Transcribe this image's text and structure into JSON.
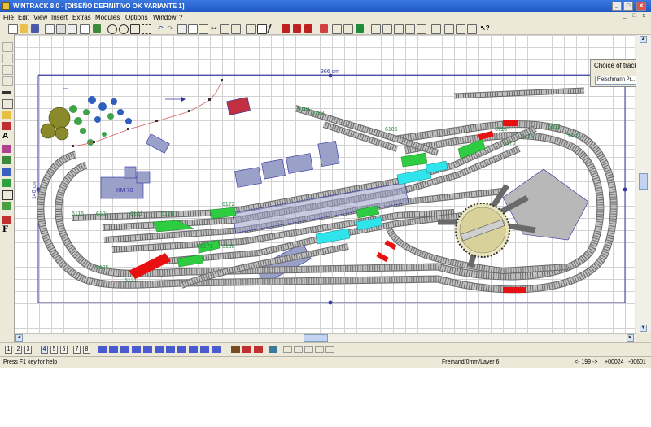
{
  "window": {
    "title": "WINTRACK 8.0 - [DISEÑO DEFINITIVO OK VARIANTE 1]",
    "controls": [
      "_",
      "□",
      "✕"
    ]
  },
  "menu": [
    "File",
    "Edit",
    "View",
    "Insert",
    "Extras",
    "Modules",
    "Options",
    "Window",
    "?"
  ],
  "mdi_controls": [
    "_",
    "□",
    "x"
  ],
  "choice_panel": {
    "title": "Choice of track",
    "selected": "Fleischmann Pr..."
  },
  "layout": {
    "width_label": "366 cm",
    "height_label": "140 cm",
    "station_label": "KM 70",
    "track_labels": [
      "6101",
      "6103",
      "6106",
      "6116",
      "6125",
      "6131",
      "6133",
      "6138",
      "6170",
      "6171",
      "6172",
      "6116",
      "6101",
      "6101",
      "6101",
      "6131",
      "6125"
    ]
  },
  "page_tabs": [
    "1",
    "2",
    "3",
    "4",
    "5",
    "6",
    "7",
    "8"
  ],
  "status": {
    "help": "Press F1 key for help",
    "mode": "Freihand/0mm/Layer 6",
    "nav": "<- 199 ->",
    "x": "+00024",
    "y": "-00601"
  },
  "colors": {
    "track": "#b5b5b5",
    "label": "#2a8a44",
    "green_switch": "#2ecc40",
    "cyan_switch": "#2fe4ea",
    "red_section": "#e81010",
    "baseboard": "#3a3aa0",
    "building": "#9aa1c8"
  }
}
